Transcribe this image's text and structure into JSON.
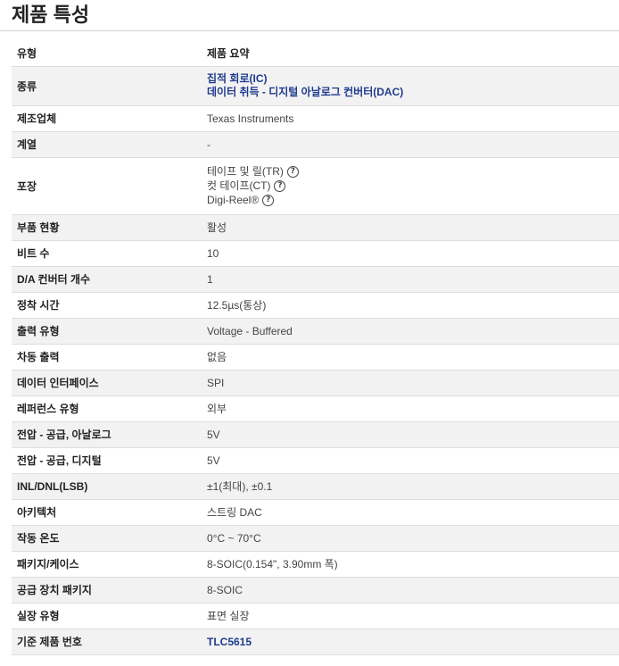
{
  "page_title": "제품 특성",
  "header": {
    "label": "유형",
    "value": "제품 요약"
  },
  "rows": {
    "category": {
      "label": "종류",
      "links": [
        "집적 회로(IC)",
        "데이터 취득 - 디지털 아날로그 컨버터(DAC)"
      ]
    },
    "manufacturer": {
      "label": "제조업체",
      "value": "Texas Instruments"
    },
    "series": {
      "label": "계열",
      "value": "-"
    },
    "packaging": {
      "label": "포장",
      "options": [
        "테이프 및 릴(TR)",
        "컷 테이프(CT)",
        "Digi-Reel®"
      ]
    },
    "part_status": {
      "label": "부품 현황",
      "value": "활성"
    },
    "bits": {
      "label": "비트 수",
      "value": "10"
    },
    "num_dac": {
      "label": "D/A 컨버터 개수",
      "value": "1"
    },
    "settling": {
      "label": "정착 시간",
      "value": "12.5µs(통상)"
    },
    "output_type": {
      "label": "출력 유형",
      "value": "Voltage - Buffered"
    },
    "diff_output": {
      "label": "차동 출력",
      "value": "없음"
    },
    "data_interface": {
      "label": "데이터 인터페이스",
      "value": "SPI"
    },
    "reference_type": {
      "label": "레퍼런스 유형",
      "value": "외부"
    },
    "supply_analog": {
      "label": "전압 - 공급, 아날로그",
      "value": "5V"
    },
    "supply_digital": {
      "label": "전압 - 공급, 디지털",
      "value": "5V"
    },
    "inl_dnl": {
      "label": "INL/DNL(LSB)",
      "value": "±1(최대), ±0.1"
    },
    "architecture": {
      "label": "아키텍처",
      "value": "스트링 DAC"
    },
    "operating_temp": {
      "label": "작동 온도",
      "value": "0°C ~ 70°C"
    },
    "package_case": {
      "label": "패키지/케이스",
      "value": "8-SOIC(0.154\", 3.90mm 폭)"
    },
    "supplier_package": {
      "label": "공급 장치 패키지",
      "value": "8-SOIC"
    },
    "mounting_type": {
      "label": "실장 유형",
      "value": "표면 실장"
    },
    "base_part": {
      "label": "기준 제품 번호",
      "value": "TLC5615"
    }
  },
  "colors": {
    "link": "#1f3a8e",
    "stripe": "#f2f2f2"
  },
  "icons": {
    "help": "question-circle-icon"
  }
}
